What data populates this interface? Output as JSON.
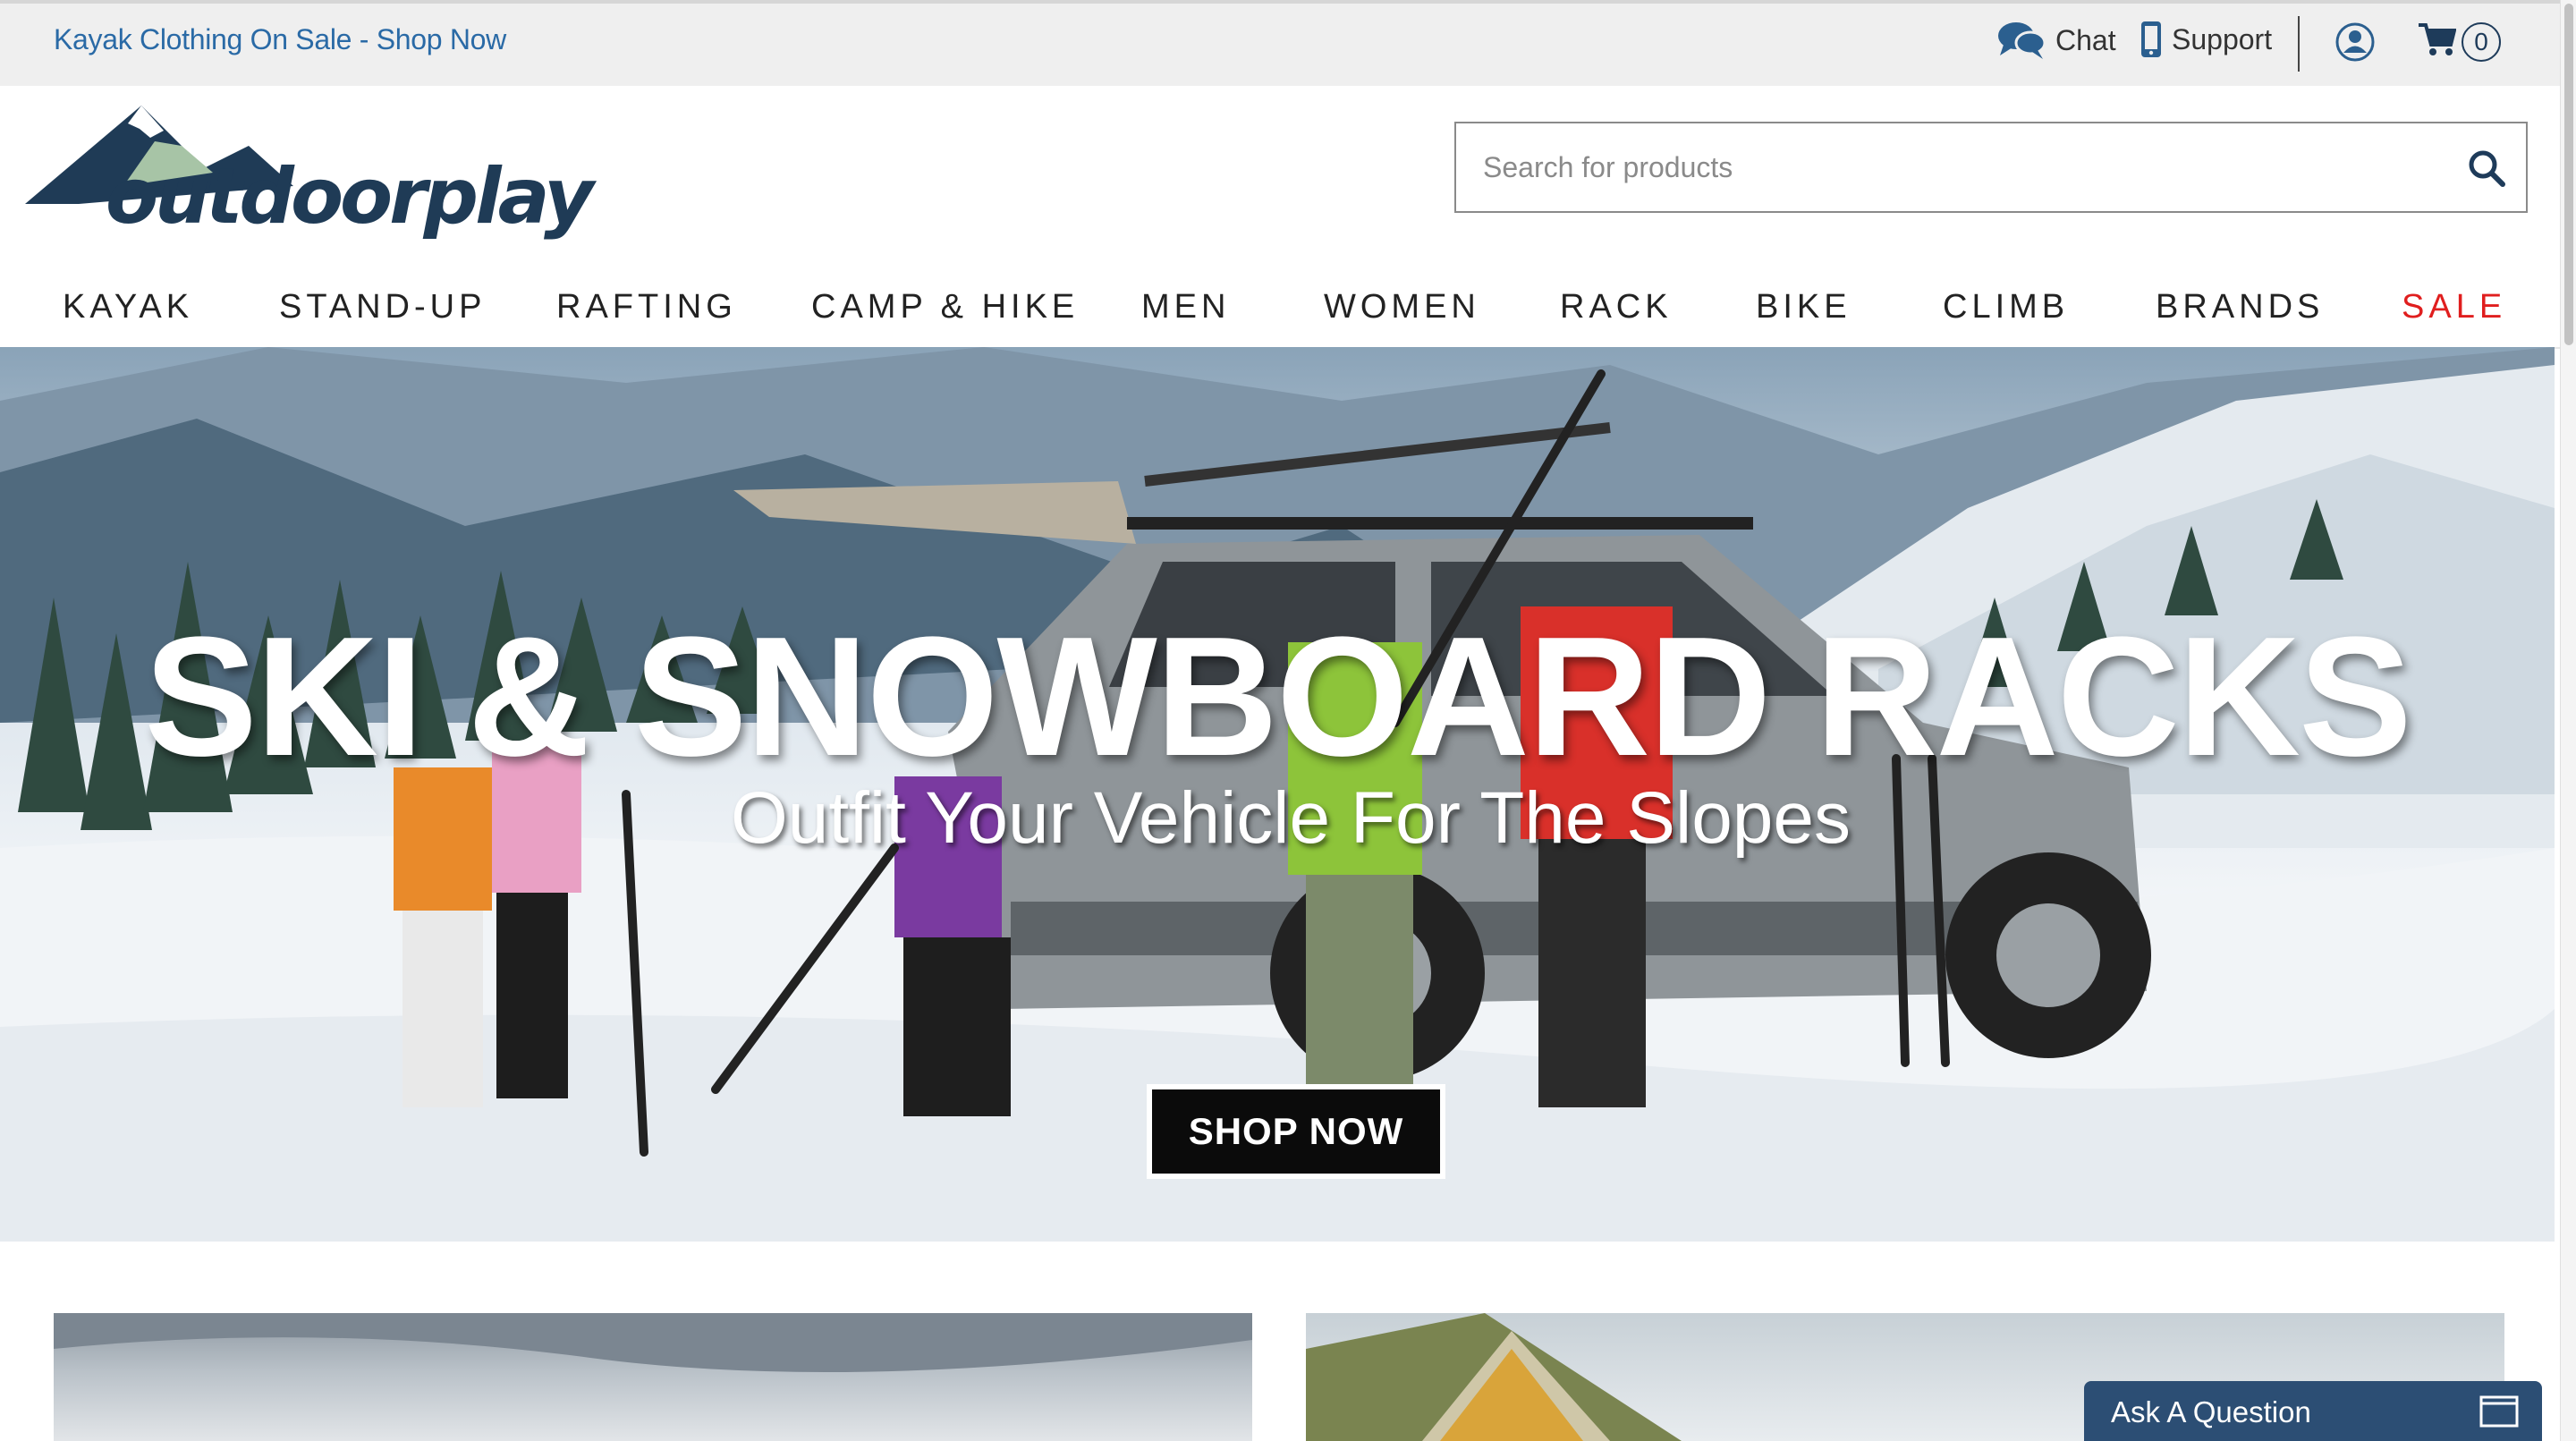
{
  "topbar": {
    "promo_text": "Kayak Clothing On Sale - Shop Now",
    "chat_label": "Chat",
    "support_label": "Support",
    "cart_count": "0"
  },
  "header": {
    "logo_text": "outdoorplay",
    "search_placeholder": "Search for products"
  },
  "nav": {
    "items": [
      "KAYAK",
      "STAND-UP",
      "RAFTING",
      "CAMP & HIKE",
      "MEN",
      "WOMEN",
      "RACK",
      "BIKE",
      "CLIMB",
      "BRANDS",
      "SALE"
    ]
  },
  "hero": {
    "title": "SKI & SNOWBOARD RACKS",
    "subtitle": "Outfit Your Vehicle For The Slopes",
    "cta_label": "SHOP NOW"
  },
  "widget": {
    "ask_label": "Ask A Question"
  },
  "colors": {
    "link_blue": "#2a6aa6",
    "brand_navy": "#1f3b56",
    "sale_red": "#e01e1e",
    "widget_blue": "#2c4e74"
  }
}
